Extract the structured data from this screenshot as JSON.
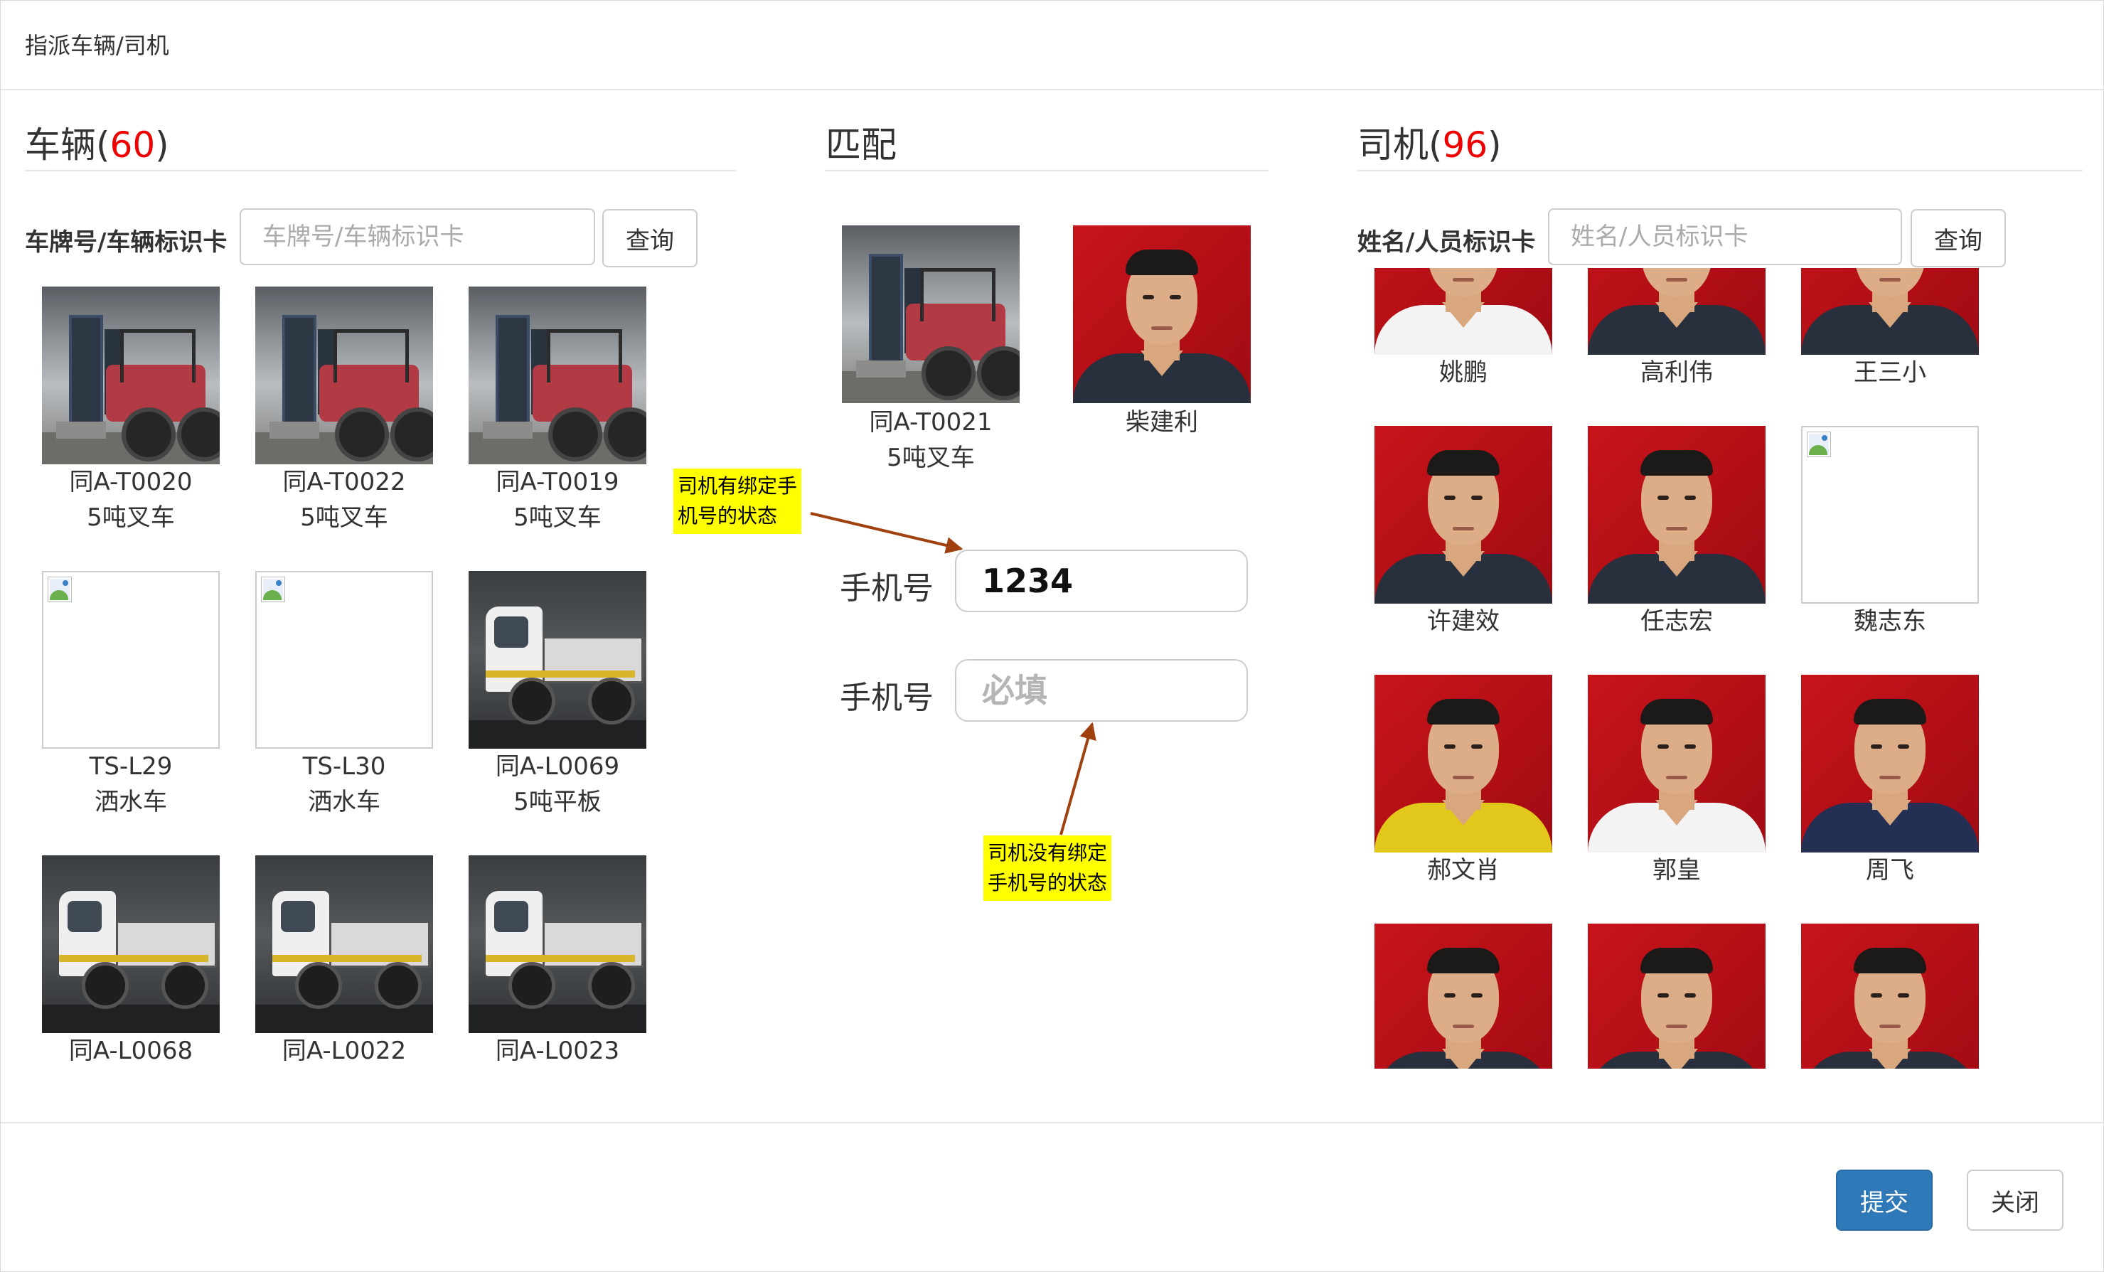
{
  "modal": {
    "title": "指派车辆/司机"
  },
  "vehicles": {
    "heading": "车辆",
    "count_open": "(",
    "count": "60",
    "count_close": ")",
    "search_label": "车牌号/车辆标识卡",
    "search_placeholder": "车牌号/车辆标识卡",
    "search_button": "查询",
    "items": [
      {
        "plate": "同A-T0020",
        "type": "5吨叉车",
        "image": "forklift"
      },
      {
        "plate": "同A-T0022",
        "type": "5吨叉车",
        "image": "forklift"
      },
      {
        "plate": "同A-T0019",
        "type": "5吨叉车",
        "image": "forklift"
      },
      {
        "plate": "TS-L29",
        "type": "洒水车",
        "image": "broken"
      },
      {
        "plate": "TS-L30",
        "type": "洒水车",
        "image": "broken"
      },
      {
        "plate": "同A-L0069",
        "type": "5吨平板",
        "image": "truck"
      },
      {
        "plate": "同A-L0068",
        "type": "",
        "image": "truck"
      },
      {
        "plate": "同A-L0022",
        "type": "",
        "image": "truck"
      },
      {
        "plate": "同A-L0023",
        "type": "",
        "image": "truck"
      }
    ]
  },
  "match": {
    "heading": "匹配",
    "vehicle": {
      "plate": "同A-T0021",
      "type": "5吨叉车"
    },
    "driver": {
      "name": "柴建利"
    },
    "phone_label_1": "手机号",
    "phone_value_1": "1234",
    "phone_label_2": "手机号",
    "phone_placeholder_2": "必填",
    "note_bound_line1": "司机有绑定手",
    "note_bound_line2": "机号的状态",
    "note_unbound_line1": "司机没有绑定",
    "note_unbound_line2": "手机号的状态"
  },
  "drivers": {
    "heading": "司机",
    "count_open": "(",
    "count": "96",
    "count_close": ")",
    "search_label": "姓名/人员标识卡",
    "search_placeholder": "姓名/人员标识卡",
    "search_button": "查询",
    "items": [
      {
        "name": "姚鹏",
        "image": "portrait",
        "shirt": "white"
      },
      {
        "name": "高利伟",
        "image": "portrait",
        "shirt": "dark"
      },
      {
        "name": "王三小",
        "image": "portrait",
        "shirt": "dark"
      },
      {
        "name": "许建效",
        "image": "portrait",
        "shirt": "dark"
      },
      {
        "name": "任志宏",
        "image": "portrait",
        "shirt": "dark"
      },
      {
        "name": "魏志东",
        "image": "broken"
      },
      {
        "name": "郝文肖",
        "image": "portrait",
        "shirt": "yellow"
      },
      {
        "name": "郭皇",
        "image": "portrait",
        "shirt": "white"
      },
      {
        "name": "周飞",
        "image": "portrait",
        "shirt": "navy"
      },
      {
        "name": "",
        "image": "portrait",
        "shirt": "dark"
      },
      {
        "name": "",
        "image": "portrait",
        "shirt": "dark"
      },
      {
        "name": "",
        "image": "portrait",
        "shirt": "dark"
      }
    ]
  },
  "footer": {
    "submit": "提交",
    "close": "关闭"
  },
  "colors": {
    "count": "#ee0000",
    "primary": "#2f79b9",
    "note_bg": "#ffff00",
    "arrow": "#a0400e"
  }
}
